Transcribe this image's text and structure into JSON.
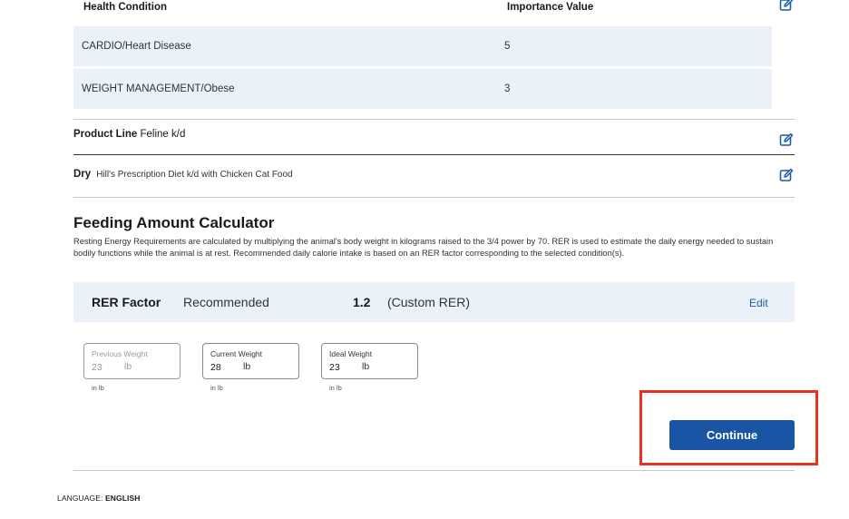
{
  "health_table": {
    "headers": {
      "condition": "Health Condition",
      "importance": "Importance Value"
    },
    "rows": [
      {
        "condition": "CARDIO/Heart Disease",
        "value": "5"
      },
      {
        "condition": "WEIGHT MANAGEMENT/Obese",
        "value": "3"
      }
    ]
  },
  "product": {
    "line_label": "Product Line",
    "line_value": "Feline k/d",
    "type_label": "Dry",
    "product_name": "Hill's Prescription Diet k/d with Chicken Cat Food"
  },
  "calculator": {
    "title": "Feeding Amount Calculator",
    "description": "Resting Energy Requirements are calculated by multiplying the animal's body weight in kilograms raised to the 3/4 power by 70. RER is used to estimate the daily energy needed to sustain bodily functions while the animal is at rest. Recommended daily calorie intake is based on an RER factor corresponding to the selected condition(s).",
    "rer_label": "RER Factor",
    "recommended_label": "Recommended",
    "rer_value": "1.2",
    "rer_note": "(Custom RER)",
    "edit_label": "Edit",
    "weights": [
      {
        "label": "Previous Weight",
        "value": "23",
        "unit": "lb",
        "sub": "in lb"
      },
      {
        "label": "Current Weight",
        "value": "28",
        "unit": "lb",
        "sub": "in lb"
      },
      {
        "label": "Ideal Weight",
        "value": "23",
        "unit": "lb",
        "sub": "in lb"
      }
    ],
    "continue_label": "Continue"
  },
  "footer": {
    "language_label": "LANGUAGE:",
    "language_value": "ENGLISH"
  },
  "colors": {
    "accent": "#1a54a4",
    "band": "#eaf1f8",
    "highlight": "#e8321f"
  },
  "icons": {
    "edit": "edit-icon"
  }
}
